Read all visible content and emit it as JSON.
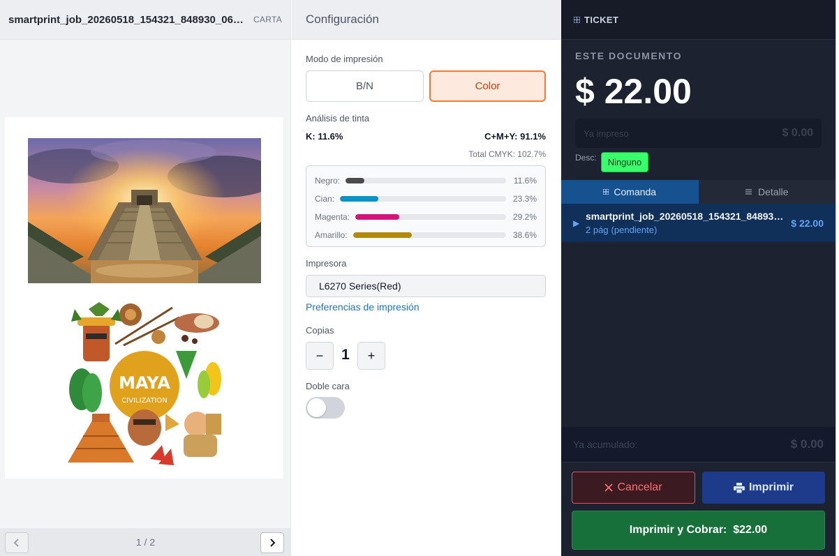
{
  "preview": {
    "file_name": "smartprint_job_20260518_154321_848930_06926...",
    "paper_size": "CARTA",
    "page_counter": "1 / 2",
    "maya_line1": "MAYA",
    "maya_line2": "CIVILIZATION"
  },
  "config": {
    "title": "Configuración",
    "print_mode_label": "Modo de impresión",
    "mode_bn": "B/N",
    "mode_color": "Color",
    "selected_mode": "Color",
    "ink_analysis_label": "Análisis de tinta",
    "k_summary": "K: 11.6%",
    "cmy_summary": "C+M+Y: 91.1%",
    "total_cmyk": "Total CMYK: 102.7%",
    "inks": [
      {
        "name": "Negro:",
        "percent": "11.6%",
        "level": 0.116,
        "color": "#4b4b4b"
      },
      {
        "name": "Cian:",
        "percent": "23.3%",
        "level": 0.233,
        "color": "#0a93c7"
      },
      {
        "name": "Magenta:",
        "percent": "29.2%",
        "level": 0.292,
        "color": "#d6137a"
      },
      {
        "name": "Amarillo:",
        "percent": "38.6%",
        "level": 0.386,
        "color": "#b08a08"
      }
    ],
    "printer_label": "Impresora",
    "printer_value": "L6270 Series(Red)",
    "print_prefs_link": "Preferencias de impresión",
    "copies_label": "Copias",
    "copies_minus": "−",
    "copies_value": "1",
    "copies_plus": "+",
    "duplex_label": "Doble cara",
    "duplex_on": false
  },
  "ticket": {
    "title": "TICKET",
    "doc_label": "ESTE DOCUMENTO",
    "doc_amount": "$ 22.00",
    "printed_label": "Ya impreso",
    "printed_amount": "$ 0.00",
    "desc_label": "Desc:",
    "desc_value": "Ninguno",
    "tab_comanda": "Comanda",
    "tab_detalle": "Detalle",
    "order": {
      "name": "smartprint_job_20260518_154321_848930_0...",
      "pages": "2 pág",
      "status": "(pendiente)",
      "price": "$ 22.00"
    },
    "accum_label": "Ya acumulado:",
    "accum_amount": "$ 0.00",
    "cancel_label": "Cancelar",
    "print_label": "Imprimir",
    "charge_label": "Imprimir y Cobrar:  $22.00"
  },
  "colors": {
    "accent_orange": "#f27a35",
    "ticket_bg": "#1d2230",
    "tab_active": "#175290",
    "charge_green": "#17703a",
    "discount_green": "#39ff6a",
    "link_blue": "#1d74bb"
  }
}
